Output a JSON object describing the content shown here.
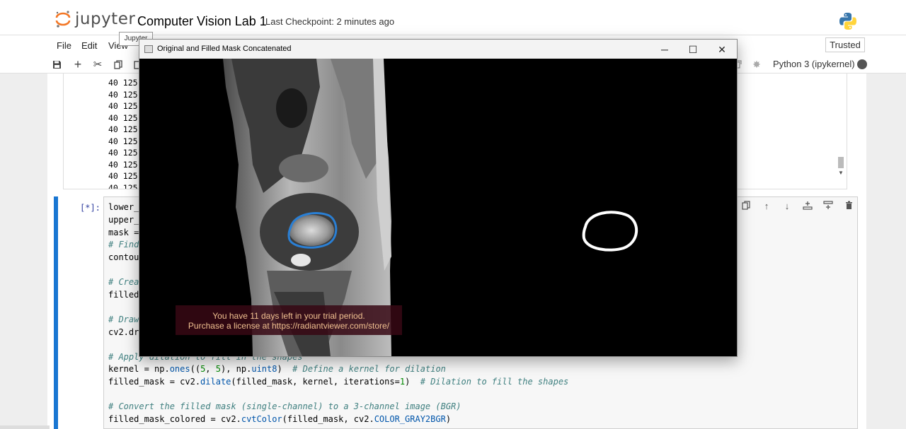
{
  "header": {
    "logo_text": "jupyter",
    "notebook_title": "Computer Vision Lab 1",
    "checkpoint": "Last Checkpoint: 2 minutes ago",
    "tooltip": "Jupyter",
    "python_logo_icon": "python-logo-icon"
  },
  "menubar": {
    "items": [
      "File",
      "Edit",
      "View"
    ],
    "trusted": "Trusted"
  },
  "toolbar": {
    "icons": [
      "save-icon",
      "add-icon",
      "cut-icon",
      "copy-icon",
      "paste-icon"
    ],
    "kernel_name": "Python 3 (ipykernel)",
    "kernel_status": "busy"
  },
  "output": {
    "lines": [
      "40 125",
      "40 125",
      "40 125",
      "40 125",
      "40 125",
      "40 125",
      "40 125",
      "40 125",
      "40 125",
      "40 125"
    ]
  },
  "cell": {
    "prompt": "[*]:",
    "code_hidden": [
      "lower_",
      "upper_",
      "mask =",
      "# Find",
      "contour",
      "# Crea",
      "filled_",
      "# Draw",
      "cv2.dra"
    ],
    "code_visible": {
      "apply_comment": "# Apply dilation to fill in the shapes",
      "kernel_a": "kernel = np.",
      "kernel_fn": "ones",
      "kernel_b": "((",
      "kernel_n1": "5",
      "kernel_c": ", ",
      "kernel_n2": "5",
      "kernel_d": "), np.",
      "kernel_fn2": "uint8",
      "kernel_e": ")  ",
      "kernel_comment": "# Define a kernel for dilation",
      "dilate_a": "filled_mask = cv2.",
      "dilate_fn": "dilate",
      "dilate_b": "(filled_mask, kernel, iterations=",
      "dilate_n": "1",
      "dilate_c": ")  ",
      "dilate_comment": "# Dilation to fill the shapes",
      "convert_comment": "# Convert the filled mask (single-channel) to a 3-channel image (BGR)",
      "color_a": "filled_mask_colored = cv2.",
      "color_fn": "cvtColor",
      "color_b": "(filled_mask, cv2.",
      "color_const": "COLOR_GRAY2BGR",
      "color_c": ")"
    }
  },
  "window": {
    "title": "Original and Filled Mask Concatenated",
    "trial_line1": "You have 11 days left in your trial period.",
    "trial_line2": "Purchase a license at https://radiantviewer.com/store/"
  },
  "colors": {
    "accent": "#1976d2",
    "prompt": "#303f9f",
    "contour": "#2a7fd4",
    "kernel_busy": "#555555"
  }
}
